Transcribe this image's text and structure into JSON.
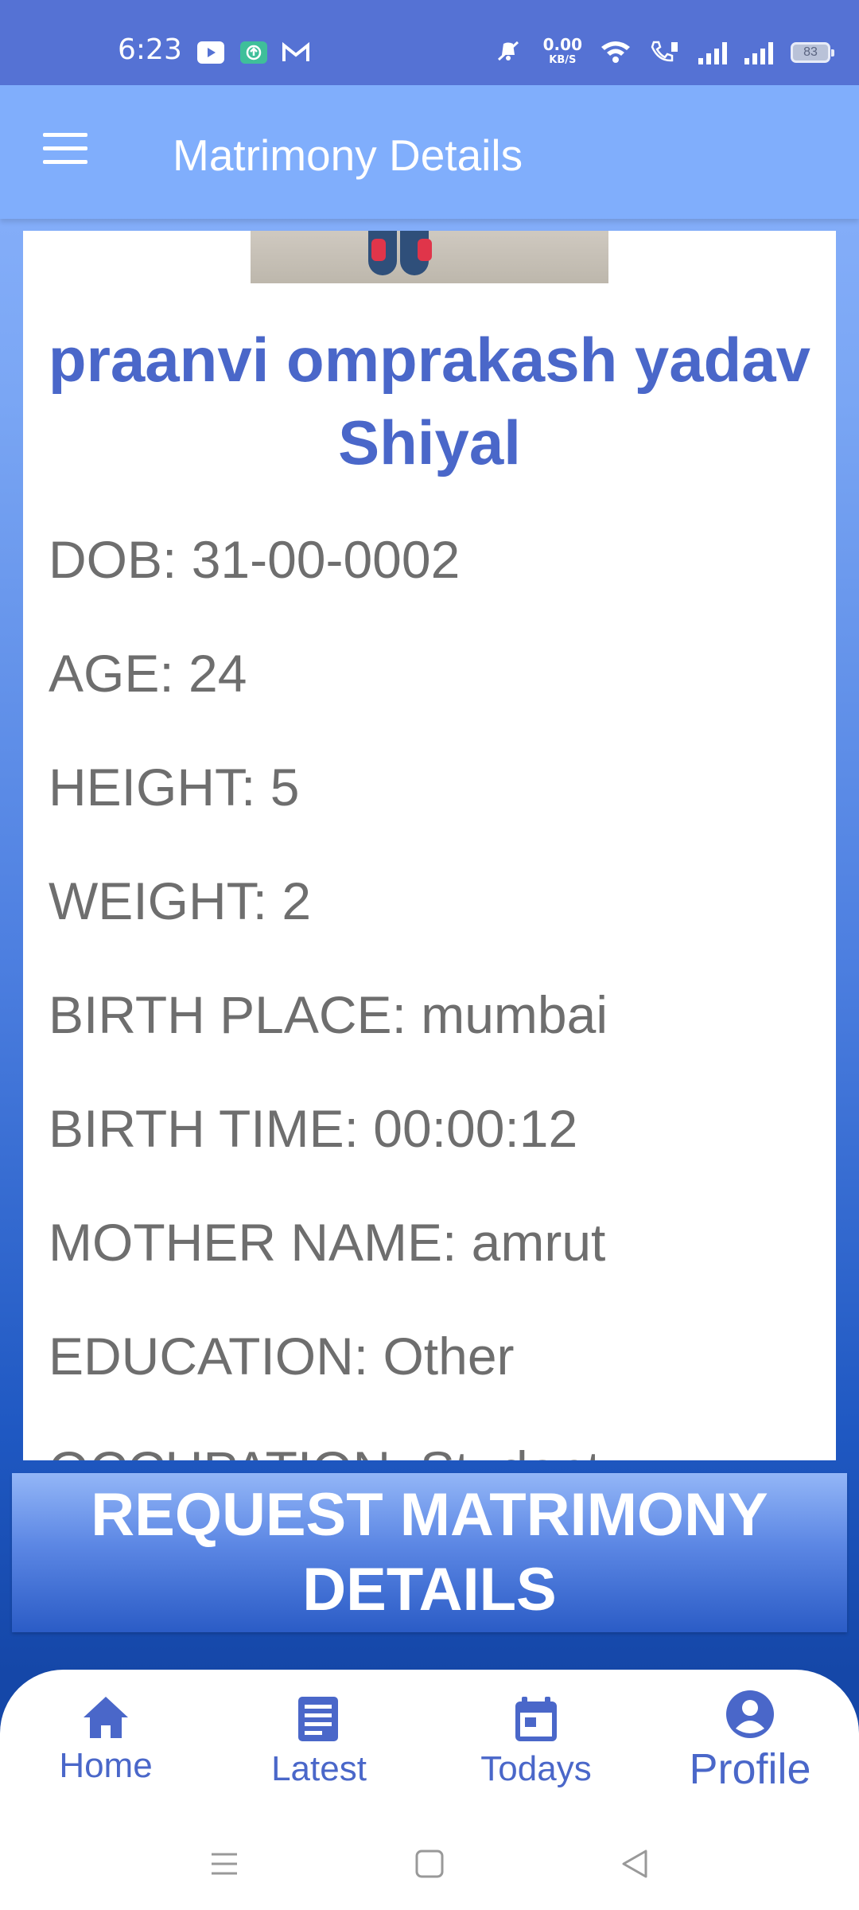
{
  "status_bar": {
    "time": "6:23",
    "net_speed_value": "0.00",
    "net_speed_unit": "KB/S",
    "battery": "83"
  },
  "app_bar": {
    "title": "Matrimony Details",
    "menu_icon": "hamburger-icon"
  },
  "profile": {
    "name": "praanvi omprakash yadav Shiyal",
    "details": [
      "DOB: 31-00-0002",
      "AGE: 24",
      "HEIGHT: 5",
      "WEIGHT: 2",
      "BIRTH PLACE: mumbai",
      "BIRTH TIME: 00:00:12",
      "MOTHER NAME: amrut",
      "EDUCATION: Other",
      "OCCUPATION: Student"
    ]
  },
  "request_button": {
    "label": "REQUEST MATRIMONY DETAILS"
  },
  "bottom_nav": {
    "items": [
      {
        "label": "Home",
        "icon": "home-icon"
      },
      {
        "label": "Latest",
        "icon": "news-icon"
      },
      {
        "label": "Todays",
        "icon": "calendar-icon"
      },
      {
        "label": "Profile",
        "icon": "profile-icon"
      }
    ]
  },
  "colors": {
    "accent": "#4a67c9",
    "status_bar": "#5572d4",
    "app_bar": "#80aefc",
    "detail_text": "#6e6e6e"
  }
}
